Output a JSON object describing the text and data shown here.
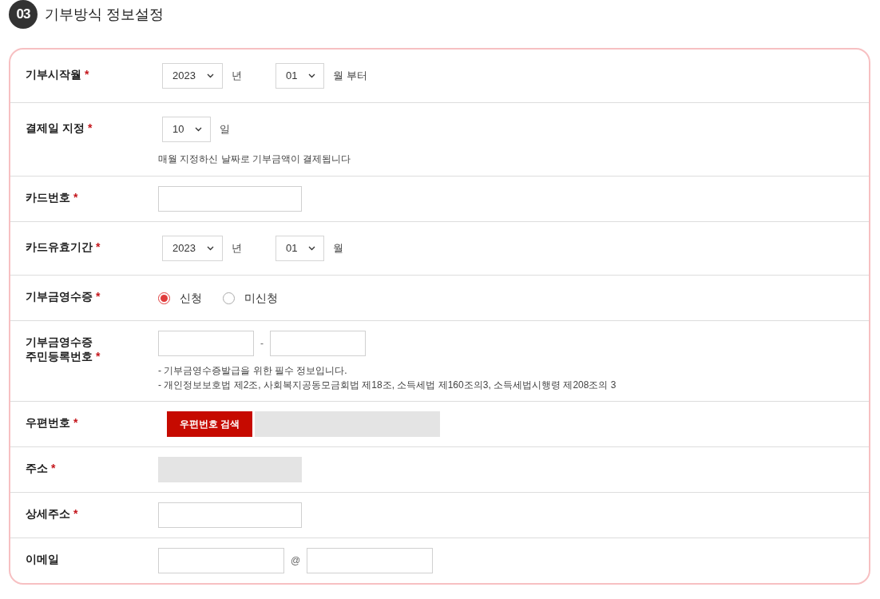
{
  "section": {
    "number": "03",
    "title": "기부방식 정보설정"
  },
  "rows": [
    {
      "kind": "date",
      "label": "기부시작월",
      "mark": "*",
      "controls": [
        {
          "kind": "select",
          "value": "2023"
        },
        {
          "kind": "unit",
          "text": "년"
        },
        {
          "kind": "select",
          "value": "01"
        },
        {
          "kind": "unit",
          "text": "월 부터"
        }
      ]
    },
    {
      "kind": "date",
      "label": "결제일 지정",
      "mark": "*",
      "controls": [
        {
          "kind": "select",
          "value": "10"
        },
        {
          "kind": "unit",
          "text": "일"
        }
      ],
      "notes": [
        "매월 지정하신 날짜로 기부금액이 결제됩니다"
      ]
    },
    {
      "kind": "text",
      "label": "카드번호",
      "mark": "*",
      "controls": [
        {
          "kind": "input"
        }
      ]
    },
    {
      "kind": "date",
      "label": "카드유효기간",
      "mark": "*",
      "controls": [
        {
          "kind": "select",
          "value": "2023"
        },
        {
          "kind": "unit",
          "text": "년"
        },
        {
          "kind": "select",
          "value": "01"
        },
        {
          "kind": "unit",
          "text": "월"
        }
      ]
    },
    {
      "kind": "radio",
      "label": "기부금영수증",
      "mark": "*",
      "controls": [
        {
          "kind": "radio",
          "text": "신청",
          "selected": true
        },
        {
          "kind": "radio",
          "text": "미신청",
          "selected": false
        }
      ]
    },
    {
      "kind": "split",
      "label": "기부금영수증\n주민등록번호",
      "mark": "*",
      "controls": [
        {
          "kind": "input"
        },
        {
          "kind": "separator",
          "text": "-"
        },
        {
          "kind": "input"
        }
      ],
      "notes": [
        "- 기부금영수증발급을 위한 필수 정보입니다.",
        "- 개인정보보호법 제2조, 사회복지공동모금회법 제18조, 소득세법 제160조의3, 소득세법시행령 제208조의 3"
      ]
    },
    {
      "kind": "zip",
      "label": "우편번호",
      "mark": "*",
      "controls": [
        {
          "kind": "button",
          "text": "우편번호 검색"
        },
        {
          "kind": "readonly"
        }
      ]
    },
    {
      "kind": "text",
      "label": "주소",
      "mark": "*",
      "controls": [
        {
          "kind": "readonly"
        }
      ]
    },
    {
      "kind": "text",
      "label": "상세주소",
      "mark": "*",
      "controls": [
        {
          "kind": "input"
        }
      ]
    },
    {
      "kind": "email",
      "label": "이메일",
      "controls": [
        {
          "kind": "input"
        },
        {
          "kind": "separator",
          "text": "@"
        },
        {
          "kind": "input"
        }
      ]
    }
  ]
}
